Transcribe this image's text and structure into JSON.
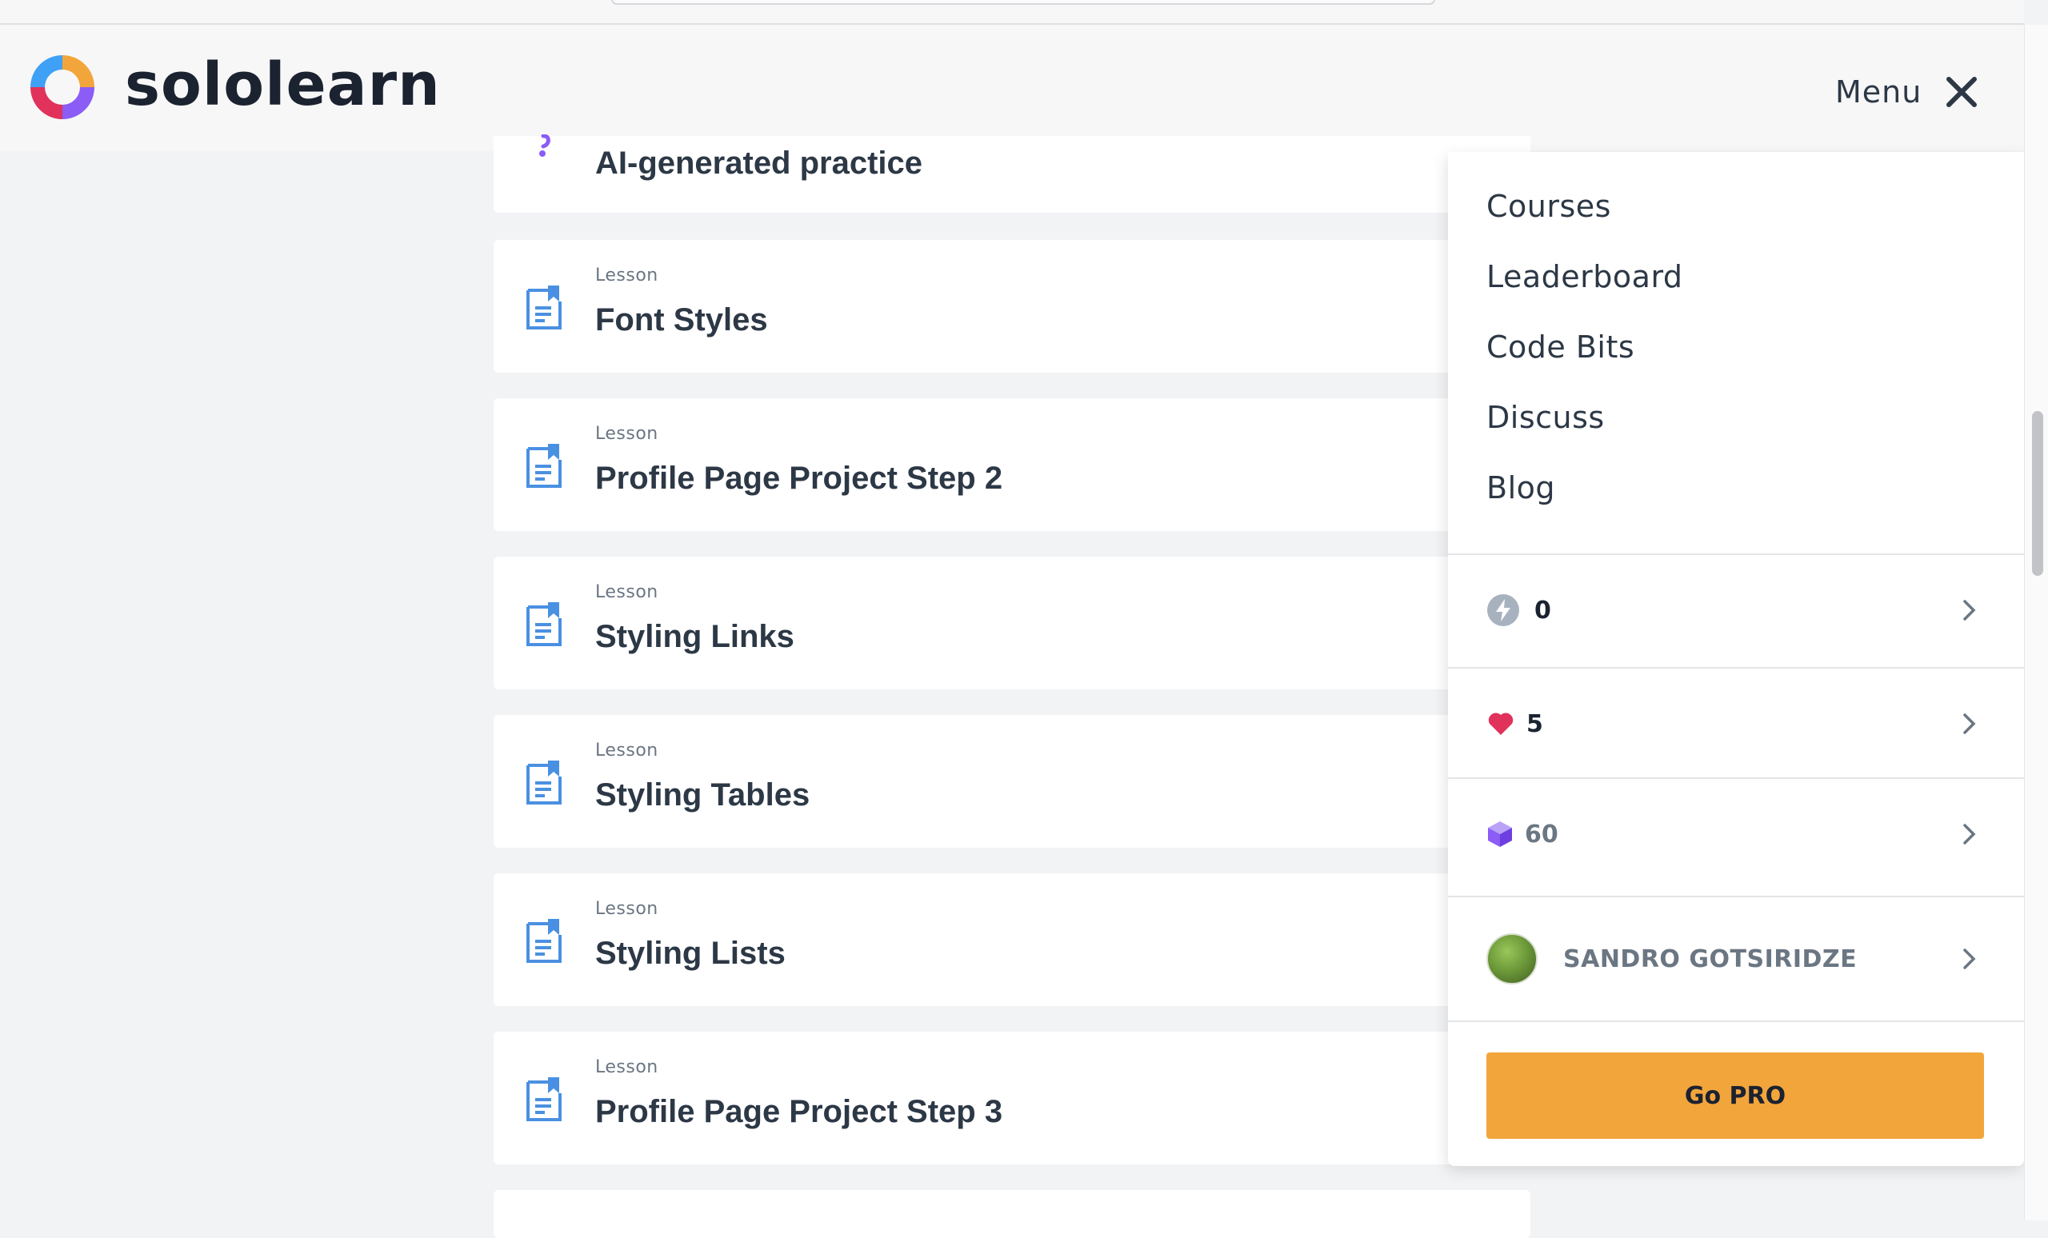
{
  "app": {
    "brand": "sololearn",
    "colors": {
      "accent": "#f2a53b",
      "link_blue": "#4a90e2",
      "heart": "#e0325a"
    }
  },
  "header": {
    "menu_label": "Menu",
    "close_icon": "close-icon",
    "logo_icon": "sololearn-logo"
  },
  "lessons": {
    "partial_title": "AI-generated practice",
    "items": [
      {
        "kind": "Lesson",
        "title": "Font Styles"
      },
      {
        "kind": "Lesson",
        "title": "Profile Page Project Step 2"
      },
      {
        "kind": "Lesson",
        "title": "Styling Links"
      },
      {
        "kind": "Lesson",
        "title": "Styling Tables"
      },
      {
        "kind": "Lesson",
        "title": "Styling Lists"
      },
      {
        "kind": "Lesson",
        "title": "Profile Page Project Step 3"
      }
    ]
  },
  "menu": {
    "links": [
      "Courses",
      "Leaderboard",
      "Code Bits",
      "Discuss",
      "Blog"
    ],
    "stats": {
      "streak": {
        "icon": "lightning-icon",
        "value": "0"
      },
      "hearts": {
        "icon": "heart-icon",
        "value": "5"
      },
      "gems": {
        "icon": "gem-icon",
        "value": "60"
      }
    },
    "profile": {
      "name": "SANDRO GOTSIRIDZE"
    },
    "go_pro_label": "Go PRO"
  }
}
